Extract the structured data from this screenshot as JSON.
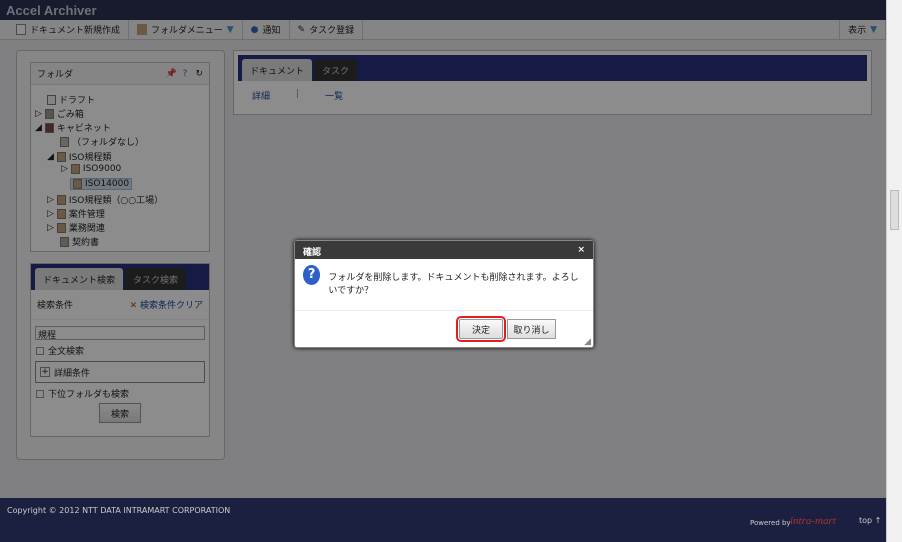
{
  "app_title": "Accel Archiver",
  "toolbar": {
    "new_doc": "ドキュメント新規作成",
    "folder_menu": "フォルダメニュー",
    "notify": "通知",
    "task_register": "タスク登録",
    "view": "表示"
  },
  "folder_panel": {
    "title": "フォルダ",
    "tree": [
      "ドラフト",
      "ごみ箱",
      "キャビネット",
      "（フォルダなし）",
      "ISO規程類",
      "ISO9000",
      "ISO14000",
      "ISO規程類（○○工場）",
      "案件管理",
      "業務関連",
      "契約書"
    ]
  },
  "search_panel": {
    "tabs": [
      "ドキュメント検索",
      "タスク検索"
    ],
    "conditions_label": "検索条件",
    "clear_link": "検索条件クリア",
    "keyword_value": "規程",
    "fulltext_label": "全文検索",
    "detail_label": "詳細条件",
    "subfolder_label": "下位フォルダも検索",
    "search_button": "検索"
  },
  "main": {
    "tabs": [
      "ドキュメント",
      "タスク"
    ],
    "links": [
      "詳細",
      "一覧"
    ],
    "separator": "|"
  },
  "dialog": {
    "title": "確認",
    "message": "フォルダを削除します。ドキュメントも削除されます。よろしいですか？",
    "ok": "決定",
    "cancel": "取り消し",
    "close": "×"
  },
  "footer": {
    "copyright": "Copyright © 2012 NTT DATA INTRAMART CORPORATION",
    "powered": "Powered by",
    "brand": "intra-mart",
    "top": "top ↑"
  }
}
